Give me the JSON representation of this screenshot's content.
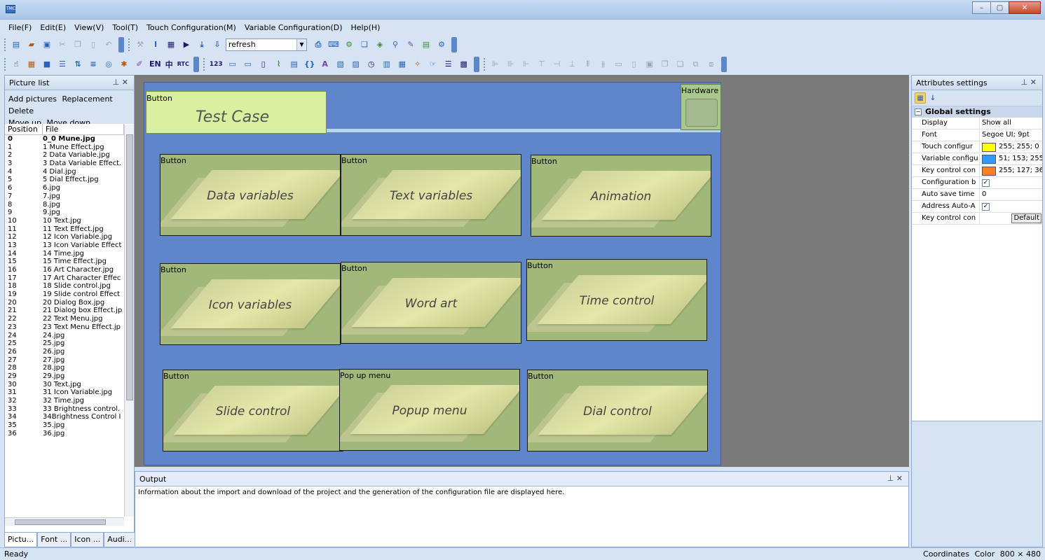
{
  "app": {
    "icon_text": "TMC"
  },
  "window_controls": {
    "minimize": "–",
    "maximize": "▢",
    "close": "✕"
  },
  "menu": [
    {
      "label": "File(F)"
    },
    {
      "label": "Edit(E)"
    },
    {
      "label": "View(V)"
    },
    {
      "label": "Tool(T)"
    },
    {
      "label": "Touch Configuration(M)"
    },
    {
      "label": "Variable Configuration(D)"
    },
    {
      "label": "Help(H)"
    }
  ],
  "toolbar": {
    "combo_value": "refresh",
    "text_icons": {
      "en": "EN",
      "zh": "中",
      "rtc": "RTC",
      "num": "123"
    }
  },
  "picture_list": {
    "title": "Picture list",
    "pin": "⊥ ✕",
    "actions": [
      "Add pictures",
      "Replacement",
      "Delete",
      "Move up",
      "Move down"
    ],
    "columns": [
      "Position",
      "File"
    ],
    "rows": [
      [
        "0",
        "0_0 Mune.jpg"
      ],
      [
        "1",
        "1 Mune Effect.jpg"
      ],
      [
        "2",
        "2 Data Variable.jpg"
      ],
      [
        "3",
        "3 Data Variable Effect."
      ],
      [
        "4",
        "4 Dial.jpg"
      ],
      [
        "5",
        "5 Dial Effect.jpg"
      ],
      [
        "6",
        "6.jpg"
      ],
      [
        "7",
        "7.jpg"
      ],
      [
        "8",
        "8.jpg"
      ],
      [
        "9",
        "9.jpg"
      ],
      [
        "10",
        "10 Text.jpg"
      ],
      [
        "11",
        "11 Text Effect.jpg"
      ],
      [
        "12",
        "12 Icon Variable.jpg"
      ],
      [
        "13",
        "13 Icon Variable Effect"
      ],
      [
        "14",
        "14 Time.jpg"
      ],
      [
        "15",
        "15 Time Effect.jpg"
      ],
      [
        "16",
        "16 Art Character.jpg"
      ],
      [
        "17",
        "17 Art Character Effec"
      ],
      [
        "18",
        "18 Slide control.jpg"
      ],
      [
        "19",
        "19 Slide control Effect"
      ],
      [
        "20",
        "20 Dialog Box.jpg"
      ],
      [
        "21",
        "21 Dialog box Effect.jp"
      ],
      [
        "22",
        "22 Text Menu.jpg"
      ],
      [
        "23",
        "23 Text Menu Effect.jp"
      ],
      [
        "24",
        "24.jpg"
      ],
      [
        "25",
        "25.jpg"
      ],
      [
        "26",
        "26.jpg"
      ],
      [
        "27",
        "27.jpg"
      ],
      [
        "28",
        "28.jpg"
      ],
      [
        "29",
        "29.jpg"
      ],
      [
        "30",
        "30 Text.jpg"
      ],
      [
        "31",
        "31 Icon Variable.jpg"
      ],
      [
        "32",
        "32 Time.jpg"
      ],
      [
        "33",
        "33 Brightness control."
      ],
      [
        "34",
        "34Brightness Control I"
      ],
      [
        "35",
        "35.jpg"
      ],
      [
        "36",
        "36.jpg"
      ]
    ],
    "tabs": [
      "Pictu...",
      "Font ...",
      "Icon ...",
      "Audi..."
    ]
  },
  "canvas": {
    "header": {
      "label": "Button",
      "title": "Test Case"
    },
    "hardware": {
      "label": "Hardware"
    },
    "tiles": [
      {
        "label": "Button",
        "title": "Data variables"
      },
      {
        "label": "Button",
        "title": "Text variables"
      },
      {
        "label": "Button",
        "title": "Animation"
      },
      {
        "label": "Button",
        "title": "Icon variables"
      },
      {
        "label": "Button",
        "title": "Word art"
      },
      {
        "label": "Button",
        "title": "Time control"
      },
      {
        "label": "Button",
        "title": "Slide control"
      },
      {
        "label": "Pop up menu",
        "title": "Popup menu"
      },
      {
        "label": "Button",
        "title": "Dial control"
      }
    ]
  },
  "output": {
    "title": "Output",
    "pin": "⊥ ✕",
    "message": "Information about the import and download of the project and the generation of the configuration file are displayed here."
  },
  "attributes": {
    "title": "Attributes settings",
    "pin": "⊥ ✕",
    "group": "Global settings",
    "rows": [
      {
        "key": "Display",
        "value": "Show all"
      },
      {
        "key": "Font",
        "value": "Segoe UI; 9pt"
      },
      {
        "key": "Touch configur",
        "value": "255; 255; 0",
        "color": "#ffff00"
      },
      {
        "key": "Variable configu",
        "value": "51; 153; 255",
        "color": "#3399ff"
      },
      {
        "key": "Key control con",
        "value": "255; 127; 36",
        "color": "#ff7f24"
      },
      {
        "key": "Configuration b",
        "check": "✓"
      },
      {
        "key": "Auto save time",
        "value": "0"
      },
      {
        "key": "Address Auto-A",
        "check": "✓"
      },
      {
        "key": "Key control con",
        "button": "Default"
      }
    ]
  },
  "status": {
    "left": "Ready",
    "coordinates": "Coordinates",
    "color": "Color",
    "resolution": "800 × 480"
  }
}
